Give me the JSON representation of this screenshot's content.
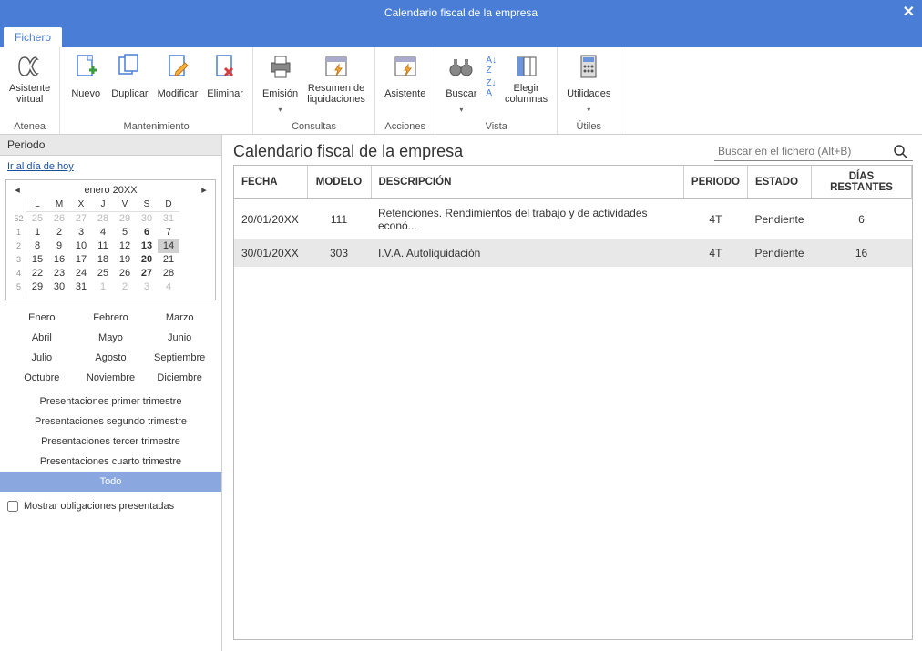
{
  "window": {
    "title": "Calendario fiscal de la empresa"
  },
  "tab": {
    "file": "Fichero"
  },
  "ribbon": {
    "atenea": {
      "label": "Asistente\nvirtual",
      "group": "Atenea"
    },
    "mant": {
      "nuevo": "Nuevo",
      "duplicar": "Duplicar",
      "modificar": "Modificar",
      "eliminar": "Eliminar",
      "group": "Mantenimiento"
    },
    "consultas": {
      "emision": "Emisión",
      "resumen": "Resumen de\nliquidaciones",
      "group": "Consultas"
    },
    "acciones": {
      "asistente": "Asistente",
      "group": "Acciones"
    },
    "vista": {
      "buscar": "Buscar",
      "columnas": "Elegir\ncolumnas",
      "group": "Vista"
    },
    "utiles": {
      "utilidades": "Utilidades",
      "group": "Útiles"
    }
  },
  "sidebar": {
    "header": "Periodo",
    "today_link": "Ir al día de hoy",
    "calendar": {
      "title": "enero  20XX",
      "weekdays": [
        "L",
        "M",
        "X",
        "J",
        "V",
        "S",
        "D"
      ],
      "weeks": [
        {
          "wk": "52",
          "days": [
            {
              "n": 25,
              "o": true
            },
            {
              "n": 26,
              "o": true
            },
            {
              "n": 27,
              "o": true
            },
            {
              "n": 28,
              "o": true
            },
            {
              "n": 29,
              "o": true
            },
            {
              "n": 30,
              "o": true
            },
            {
              "n": 31,
              "o": true
            }
          ]
        },
        {
          "wk": "1",
          "days": [
            {
              "n": 1
            },
            {
              "n": 2
            },
            {
              "n": 3
            },
            {
              "n": 4
            },
            {
              "n": 5
            },
            {
              "n": 6,
              "b": true
            },
            {
              "n": 7
            }
          ]
        },
        {
          "wk": "2",
          "days": [
            {
              "n": 8
            },
            {
              "n": 9
            },
            {
              "n": 10
            },
            {
              "n": 11
            },
            {
              "n": 12
            },
            {
              "n": 13,
              "b": true
            },
            {
              "n": 14,
              "t": true
            }
          ]
        },
        {
          "wk": "3",
          "days": [
            {
              "n": 15
            },
            {
              "n": 16
            },
            {
              "n": 17
            },
            {
              "n": 18
            },
            {
              "n": 19
            },
            {
              "n": 20,
              "b": true
            },
            {
              "n": 21
            }
          ]
        },
        {
          "wk": "4",
          "days": [
            {
              "n": 22
            },
            {
              "n": 23
            },
            {
              "n": 24
            },
            {
              "n": 25
            },
            {
              "n": 26
            },
            {
              "n": 27,
              "b": true
            },
            {
              "n": 28
            }
          ]
        },
        {
          "wk": "5",
          "days": [
            {
              "n": 29
            },
            {
              "n": 30
            },
            {
              "n": 31
            },
            {
              "n": 1,
              "o": true
            },
            {
              "n": 2,
              "o": true
            },
            {
              "n": 3,
              "o": true
            },
            {
              "n": 4,
              "o": true
            }
          ]
        }
      ]
    },
    "months": [
      "Enero",
      "Febrero",
      "Marzo",
      "Abril",
      "Mayo",
      "Junio",
      "Julio",
      "Agosto",
      "Septiembre",
      "Octubre",
      "Noviembre",
      "Diciembre"
    ],
    "presets": [
      "Presentaciones primer trimestre",
      "Presentaciones segundo trimestre",
      "Presentaciones tercer trimestre",
      "Presentaciones cuarto trimestre",
      "Todo"
    ],
    "selected_preset": 4,
    "checkbox_label": "Mostrar obligaciones presentadas"
  },
  "main": {
    "title": "Calendario fiscal de la empresa",
    "search_placeholder": "Buscar en el fichero (Alt+B)",
    "columns": {
      "fecha": "FECHA",
      "modelo": "MODELO",
      "desc": "DESCRIPCIÓN",
      "periodo": "PERIODO",
      "estado": "ESTADO",
      "dias": "DÍAS RESTANTES"
    },
    "rows": [
      {
        "fecha": "20/01/20XX",
        "modelo": "111",
        "desc": "Retenciones. Rendimientos del trabajo y de actividades econó...",
        "periodo": "4T",
        "estado": "Pendiente",
        "dias": "6"
      },
      {
        "fecha": "30/01/20XX",
        "modelo": "303",
        "desc": "I.V.A. Autoliquidación",
        "periodo": "4T",
        "estado": "Pendiente",
        "dias": "16"
      }
    ]
  }
}
